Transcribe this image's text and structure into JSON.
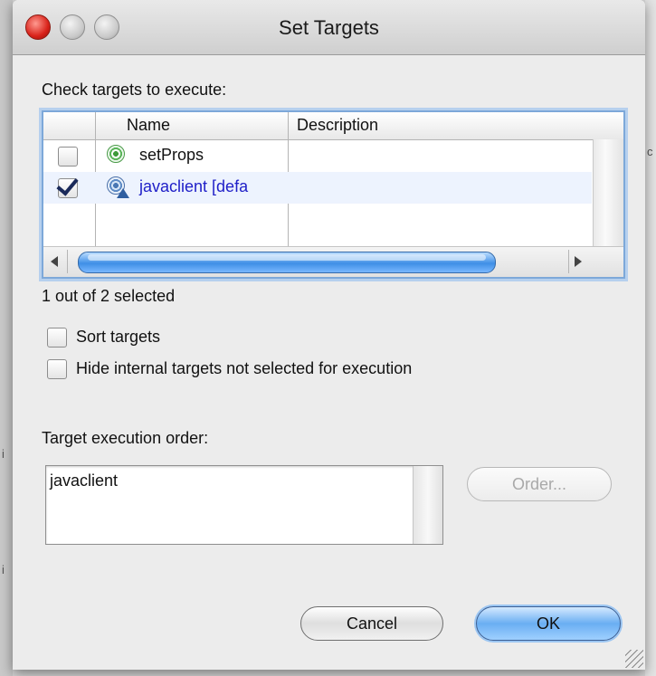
{
  "window": {
    "title": "Set Targets"
  },
  "targets": {
    "label": "Check targets to execute:",
    "columns": {
      "name": "Name",
      "description": "Description"
    },
    "rows": [
      {
        "name": "setProps",
        "description": "",
        "checked": false,
        "icon": "target-icon"
      },
      {
        "name": "javaclient [defa",
        "description": "",
        "checked": true,
        "icon": "default-target-icon",
        "color": "#2020c8"
      }
    ],
    "selection_status": "1 out of 2 selected"
  },
  "options": {
    "sort_targets": {
      "label": "Sort targets",
      "checked": false
    },
    "hide_internal": {
      "label": "Hide internal targets not selected for execution",
      "checked": false
    }
  },
  "execution_order": {
    "label": "Target execution order:",
    "items": [
      "javaclient"
    ],
    "order_button": "Order..."
  },
  "buttons": {
    "cancel": "Cancel",
    "ok": "OK"
  },
  "background": {
    "left_ticks": [
      "i",
      "i"
    ],
    "right_tick": "c"
  },
  "colors": {
    "accent": "#3f8fe6",
    "link_text": "#2020c8"
  }
}
